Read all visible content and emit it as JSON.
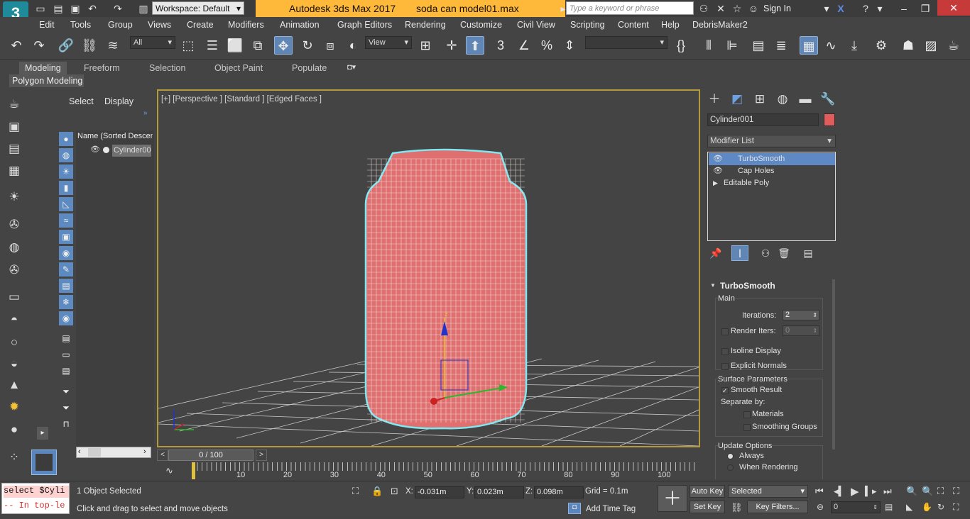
{
  "title_bar": {
    "app_title": "Autodesk 3ds Max 2017",
    "file_name": "soda can model01.max",
    "workspace_label": "Workspace: Default",
    "search_placeholder": "Type a keyword or phrase",
    "sign_in": "Sign In"
  },
  "menu": [
    "Edit",
    "Tools",
    "Group",
    "Views",
    "Create",
    "Modifiers",
    "Animation",
    "Graph Editors",
    "Rendering",
    "Customize",
    "Civil View",
    "Scripting",
    "Content",
    "Help",
    "DebrisMaker2"
  ],
  "toolbar": {
    "selection_filter": "All",
    "ref_coord": "View"
  },
  "ribbon": {
    "tabs": [
      "Modeling",
      "Freeform",
      "Selection",
      "Object Paint",
      "Populate"
    ],
    "active_tab": "Modeling",
    "sub_label": "Polygon Modeling"
  },
  "scene_explorer": {
    "tabs": [
      "Select",
      "Display"
    ],
    "column_header": "Name (Sorted Descen",
    "items": [
      "Cylinder00"
    ]
  },
  "viewport": {
    "label": "[+] [Perspective ] [Standard ] [Edged Faces ]",
    "gizmo_axis_z": "z",
    "object_color": "#e07070"
  },
  "command_panel": {
    "object_name": "Cylinder001",
    "object_color": "#e25c5c",
    "modifier_list": "Modifier List",
    "stack": [
      {
        "label": "TurboSmooth",
        "selected": true,
        "eye": true
      },
      {
        "label": "Cap Holes",
        "selected": false,
        "eye": true
      },
      {
        "label": "Editable Poly",
        "selected": false,
        "eye": false
      }
    ],
    "rollout_title": "TurboSmooth",
    "main_group": "Main",
    "iterations_label": "Iterations:",
    "iterations_value": "2",
    "render_iters_label": "Render Iters:",
    "render_iters_value": "0",
    "isoline_display": "Isoline Display",
    "explicit_normals": "Explicit Normals",
    "surface_group": "Surface Parameters",
    "smooth_result": "Smooth Result",
    "separate_by": "Separate by:",
    "materials": "Materials",
    "smoothing_groups": "Smoothing Groups",
    "update_group": "Update Options",
    "always": "Always",
    "when_rendering": "When Rendering"
  },
  "time": {
    "slider_text": "0 / 100",
    "ticks": [
      "10",
      "20",
      "30",
      "40",
      "50",
      "60",
      "70",
      "80",
      "90",
      "100"
    ]
  },
  "status": {
    "maxscript_line1": "select $Cyli",
    "maxscript_line2": "-- In top-le",
    "selection_info": "1 Object Selected",
    "prompt": "Click and drag to select and move objects",
    "x_label": "X:",
    "x_value": "-0.031m",
    "y_label": "Y:",
    "y_value": "0.023m",
    "z_label": "Z:",
    "z_value": "0.098m",
    "grid": "Grid = 0.1m",
    "add_time_tag": "Add Time Tag",
    "auto_key": "Auto Key",
    "set_key": "Set Key",
    "selected_dropdown": "Selected",
    "key_filters": "Key Filters...",
    "frame_value": "0"
  }
}
